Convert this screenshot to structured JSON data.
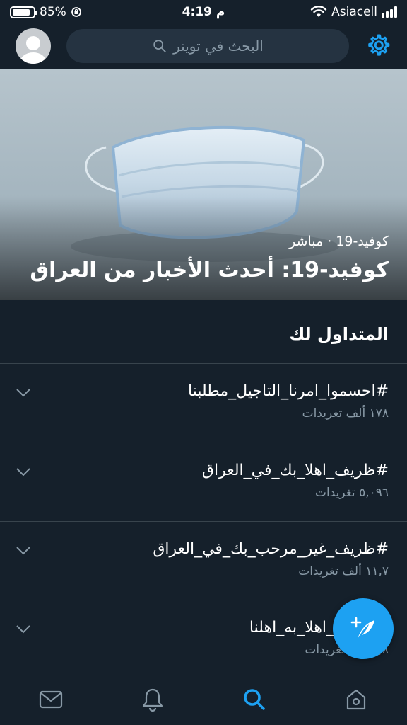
{
  "status_bar": {
    "battery": "85%",
    "battery_level": 0.85,
    "time": "4:19 م",
    "carrier": "Asiacell"
  },
  "header": {
    "search_placeholder": "البحث في تويتر"
  },
  "hero": {
    "meta": "كوفيد-19 · مباشر",
    "title": "كوفيد-19: أحدث الأخبار من العراق"
  },
  "trends": {
    "section_title": "المتداول لك",
    "items": [
      {
        "tag": "#احسموا_امرنا_التاجيل_مطلبنا",
        "count": "١٧٨ ألف تغريدات"
      },
      {
        "tag": "#ظريف_اهلا_بك_في_العراق",
        "count": "٥,٠٩٦ تغريدات"
      },
      {
        "tag": "#ظريف_غير_مرحب_بك_في_العراق",
        "count": "١١,٧ ألف تغريدات"
      },
      {
        "tag": "#ظريف_اهلا_به_اهلنا",
        "count": "٤,٨ ألف تغريدات"
      }
    ]
  },
  "colors": {
    "background": "#15202b",
    "accent": "#1da1f2",
    "secondary_text": "#8899a6",
    "divider": "#38444d"
  },
  "icons": {
    "home": "home-icon",
    "search": "search-icon",
    "notifications": "bell-icon",
    "messages": "mail-icon",
    "settings": "gear-icon",
    "compose": "compose-tweet-icon"
  }
}
